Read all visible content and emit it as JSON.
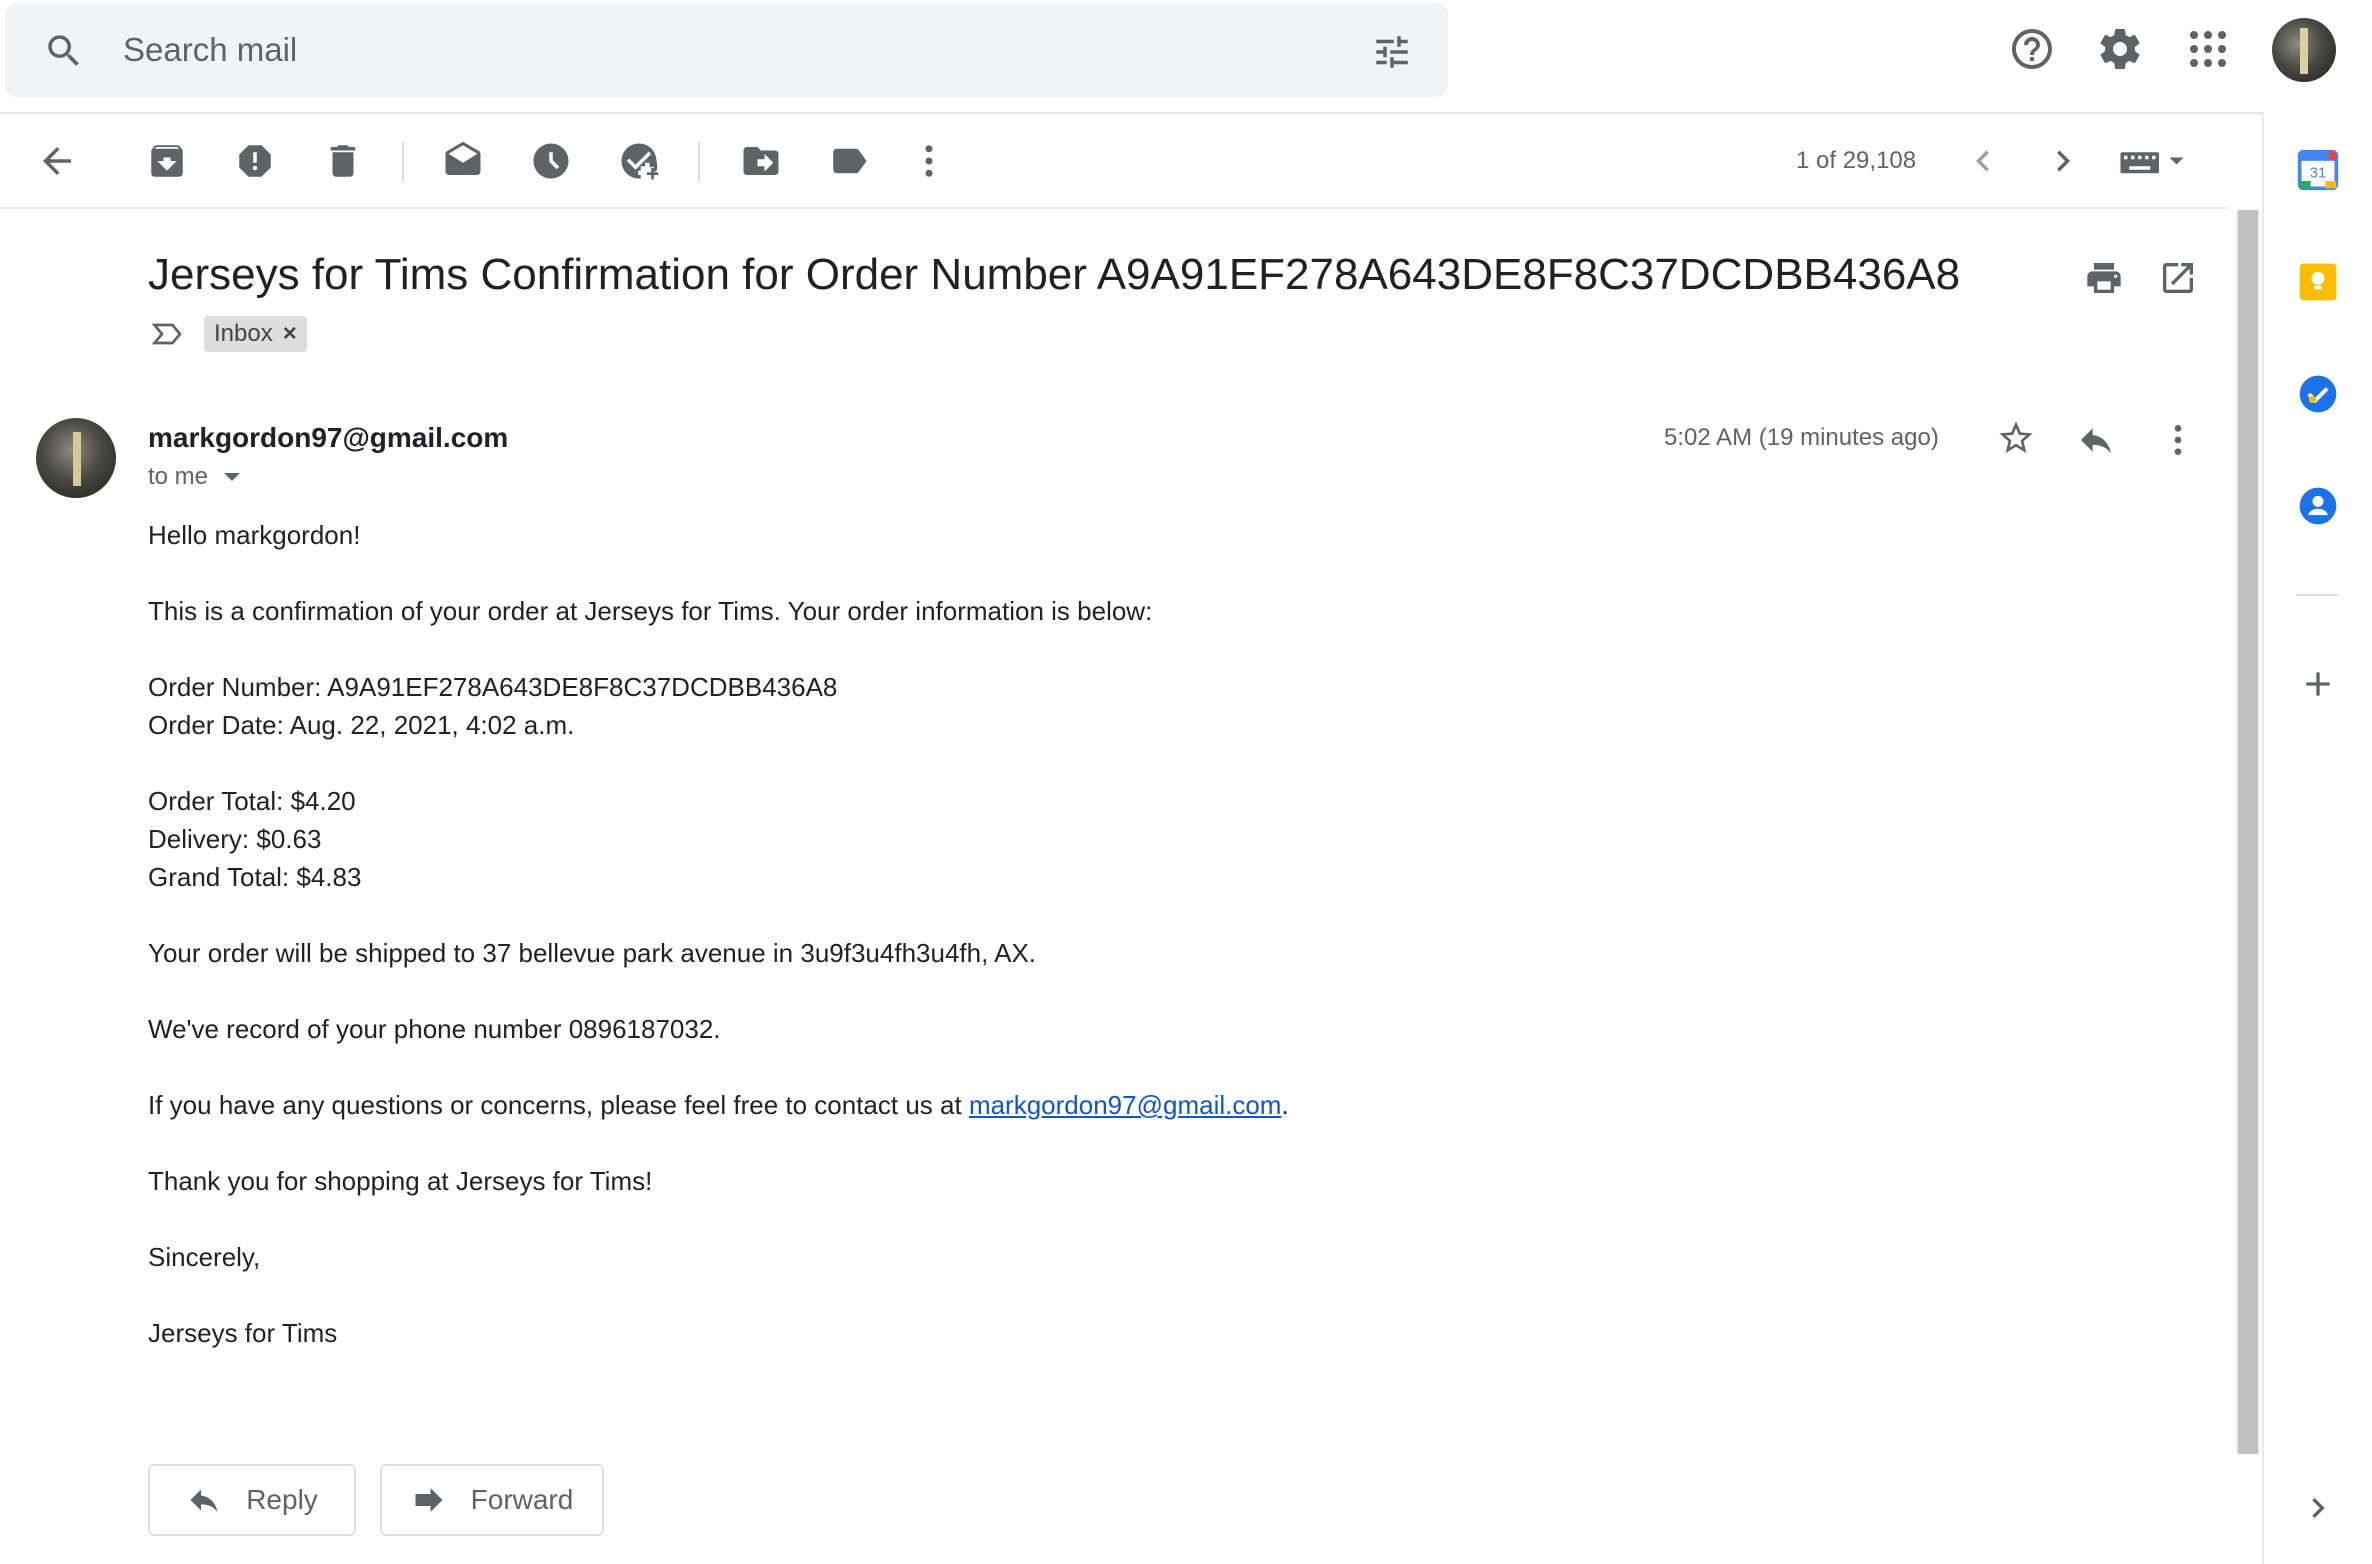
{
  "search": {
    "placeholder": "Search mail"
  },
  "toolbar": {
    "pager_text": "1 of 29,108"
  },
  "email": {
    "subject": "Jerseys for Tims Confirmation for Order Number A9A91EF278A643DE8F8C37DCDBB436A8",
    "label_chip": "Inbox",
    "label_remove": "×",
    "sender": "markgordon97@gmail.com",
    "recipient_text": "to me",
    "time": "5:02 AM (19 minutes ago)",
    "body": {
      "greeting": "Hello markgordon!",
      "intro": "This is a confirmation of your order at Jerseys for Tims. Your order information is below:",
      "order_number": "Order Number: A9A91EF278A643DE8F8C37DCDBB436A8",
      "order_date": "Order Date: Aug. 22, 2021, 4:02 a.m.",
      "order_total": "Order Total: $4.20",
      "delivery": "Delivery: $0.63",
      "grand_total": "Grand Total: $4.83",
      "shipping": "Your order will be shipped to 37 bellevue park avenue in 3u9f3u4fh3u4fh, AX.",
      "phone": "We've record of your phone number 0896187032.",
      "contact_prefix": "If you have any questions or concerns, please feel free to contact us at ",
      "contact_email": "markgordon97@gmail.com",
      "contact_suffix": ".",
      "thanks": "Thank you for shopping at Jerseys for Tims!",
      "signoff": "Sincerely,",
      "signature": "Jerseys for Tims"
    }
  },
  "actions": {
    "reply_label": "Reply",
    "forward_label": "Forward"
  },
  "side_panel": {
    "calendar_day": "31"
  },
  "colors": {
    "link": "#1155cc",
    "calendar_blue": "#4285f4",
    "keep_yellow": "#fbbc04",
    "tasks_blue": "#1a73e8",
    "contacts_blue": "#1a73e8"
  }
}
